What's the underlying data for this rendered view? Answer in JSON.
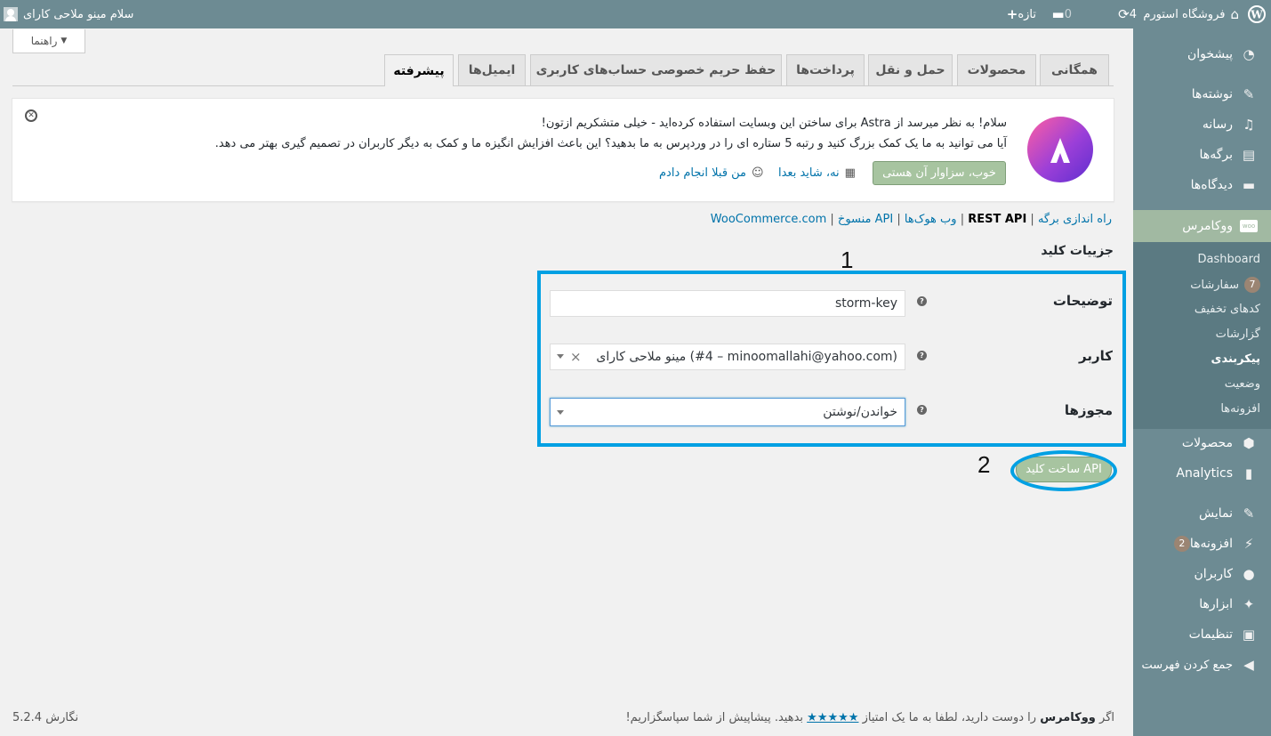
{
  "admin_bar": {
    "site_name": "فروشگاه استورم",
    "updates_count": "4",
    "comments_count": "0",
    "new_label": "تازه",
    "greeting": "سلام مینو ملاحی کارای"
  },
  "sidebar": {
    "dashboard": "پیشخوان",
    "posts": "نوشته‌ها",
    "media": "رسانه",
    "pages": "برگه‌ها",
    "comments": "دیدگاه‌ها",
    "woocommerce": "ووکامرس",
    "woo_badge": "woo",
    "submenu": {
      "dashboard": "Dashboard",
      "orders": "سفارشات",
      "orders_badge": "7",
      "coupons": "کدهای تخفیف",
      "reports": "گزارشات",
      "settings": "پیکربندی",
      "status": "وضعیت",
      "extensions": "افزونه‌ها"
    },
    "products": "محصولات",
    "analytics": "Analytics",
    "appearance": "نمایش",
    "plugins": "افزونه‌ها",
    "plugins_badge": "2",
    "users": "کاربران",
    "tools": "ابزارها",
    "settings": "تنظیمات",
    "collapse": "جمع کردن فهرست"
  },
  "help_tab": "راهنما",
  "tabs": [
    "همگانی",
    "محصولات",
    "حمل و نقل",
    "پرداخت‌ها",
    "حفظ حریم خصوصی حساب‌های کاربری",
    "ایمیل‌ها",
    "پیشرفته"
  ],
  "notice": {
    "line1": "سلام! به نظر میرسد از Astra برای ساختن این وبسایت استفاده کرده‌اید - خیلی متشکریم ازتون!",
    "line2": "آیا می توانید به ما یک کمک بزرگ کنید و رتبه 5 ستاره ای را در وردپرس به ما بدهید؟ این باعث افزایش انگیزه ما و کمک به دیگر کاربران در تصمیم گیری بهتر می دهد.",
    "rate_button": "خوب، سزاوار آن هستی",
    "later_link": "نه، شاید بعدا",
    "done_link": "من قبلا انجام دادم"
  },
  "subsub": {
    "page_setup": "راه اندازی برگه",
    "rest_api": "REST API",
    "webhooks": "وب هوک‌ها",
    "legacy_api": "API منسوخ",
    "woocommerce_com": "WooCommerce.com"
  },
  "section_title": "جزییات کلید",
  "annotations": {
    "one": "1",
    "two": "2"
  },
  "form": {
    "description_label": "توضیحات",
    "description_value": "storm-key",
    "user_label": "کاربر",
    "user_value": "مینو ملاحی کارای (#4 – minoomallahi@yahoo.com)",
    "permissions_label": "مجوزها",
    "permissions_value": "خواندن/نوشتن",
    "help_symbol": "?"
  },
  "generate_button": "ساخت کلید API",
  "footer": {
    "prefix": "اگر",
    "brand": "ووکامرس",
    "middle": "را دوست دارید، لطفا به ما یک امتیاز",
    "stars": "★★★★★",
    "suffix": "بدهید. پیشاپیش از شما سپاسگزاریم!",
    "version": "نگارش 5.2.4"
  },
  "colors": {
    "admin_bar": "#6d8b93",
    "sidebar_active": "#a1b9a2",
    "highlight": "#00a0e3",
    "button": "#a7c4a0"
  }
}
